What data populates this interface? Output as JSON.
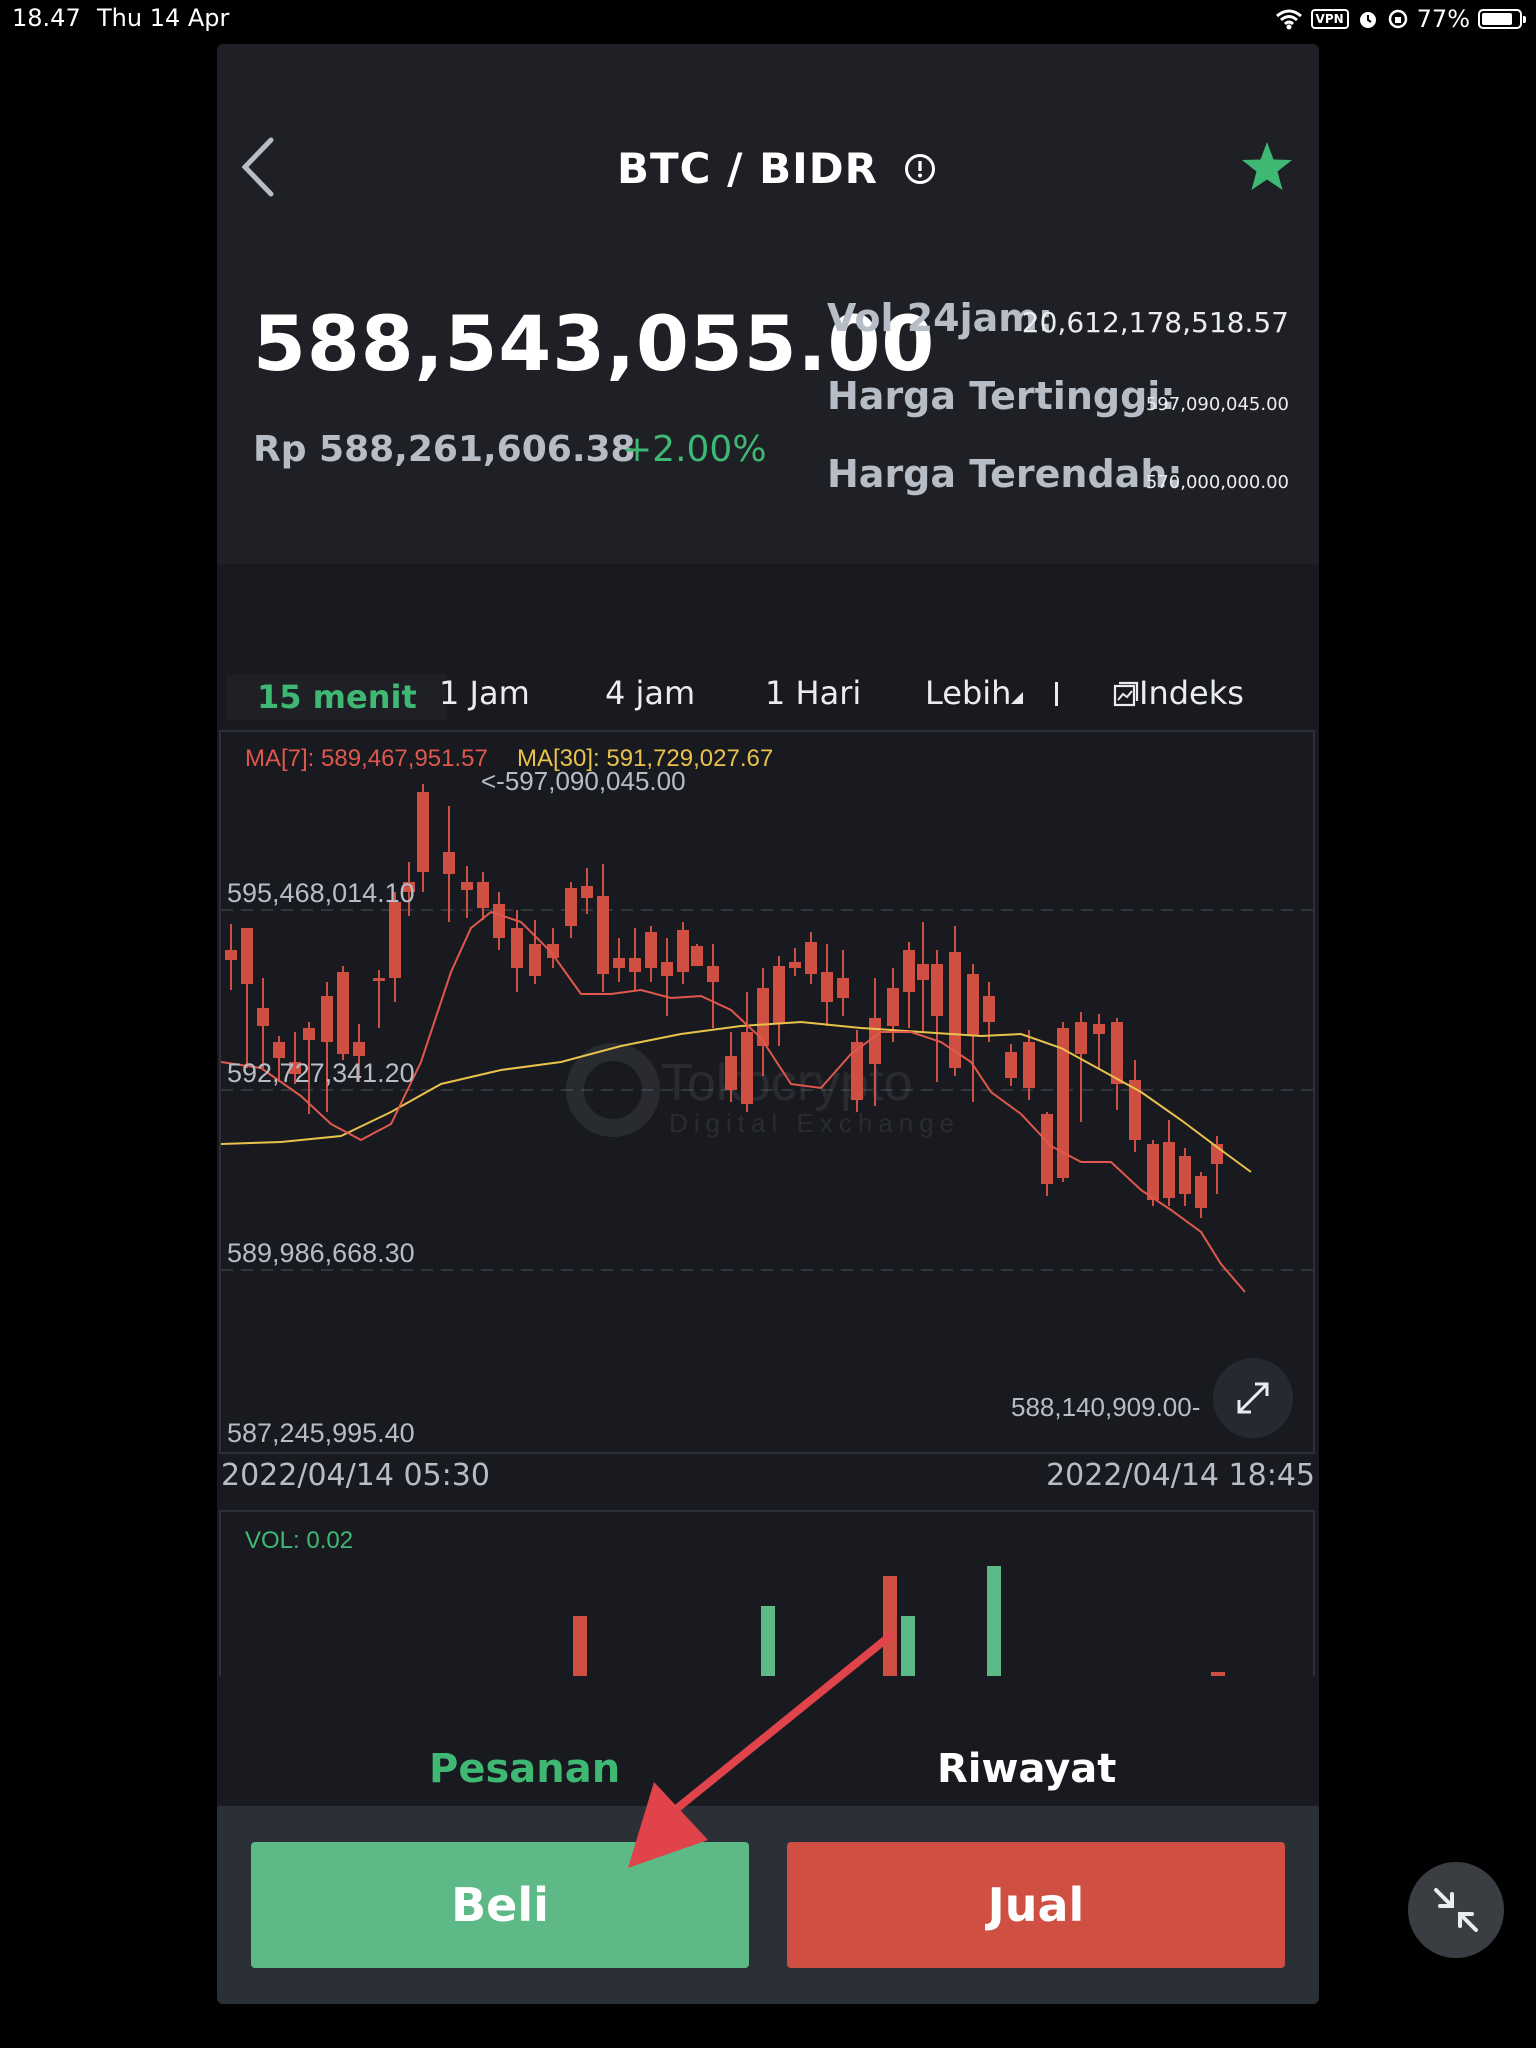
{
  "status_bar": {
    "time": "18.47",
    "date": "Thu 14 Apr",
    "vpn": "VPN",
    "battery": "77%"
  },
  "header": {
    "pair": "BTC / BIDR",
    "last_price": "588,543,055.00",
    "fiat_price": "Rp 588,261,606.38",
    "change": "+2.00%",
    "stats": [
      {
        "label": "Vol 24jam:",
        "value": "20,612,178,518.57"
      },
      {
        "label": "Harga Tertinggi:",
        "value": "597,090,045.00"
      },
      {
        "label": "Harga Terendah:",
        "value": "570,000,000.00"
      }
    ]
  },
  "timeframes": {
    "items": [
      "15 menit",
      "1 Jam",
      "4 jam",
      "1 Hari",
      "Lebih"
    ],
    "active": "15 menit",
    "indicator_label": "Indeks"
  },
  "chart": {
    "ma7_label": "MA[7]: 589,467,951.57",
    "ma30_label": "MA[30]: 591,729,027.67",
    "high_marker": "<-597,090,045.00",
    "low_marker": "588,140,909.00-",
    "y_labels": [
      "595,468,014.10",
      "592,727,341.20",
      "589,986,668.30",
      "587,245,995.40"
    ],
    "start_date": "2022/04/14 05:30",
    "end_date": "2022/04/14 18:45",
    "watermark_main": "Tokocrypto",
    "watermark_sub": "Digital Exchange",
    "vol_label": "VOL: 0.02",
    "colors": {
      "up": "#5dba87",
      "down": "#cf4f43",
      "ma7": "#e0584c",
      "ma30": "#e9c24b"
    }
  },
  "bottom_tabs": {
    "orders": "Pesanan",
    "history": "Riwayat"
  },
  "actions": {
    "buy": "Beli",
    "sell": "Jual"
  }
}
